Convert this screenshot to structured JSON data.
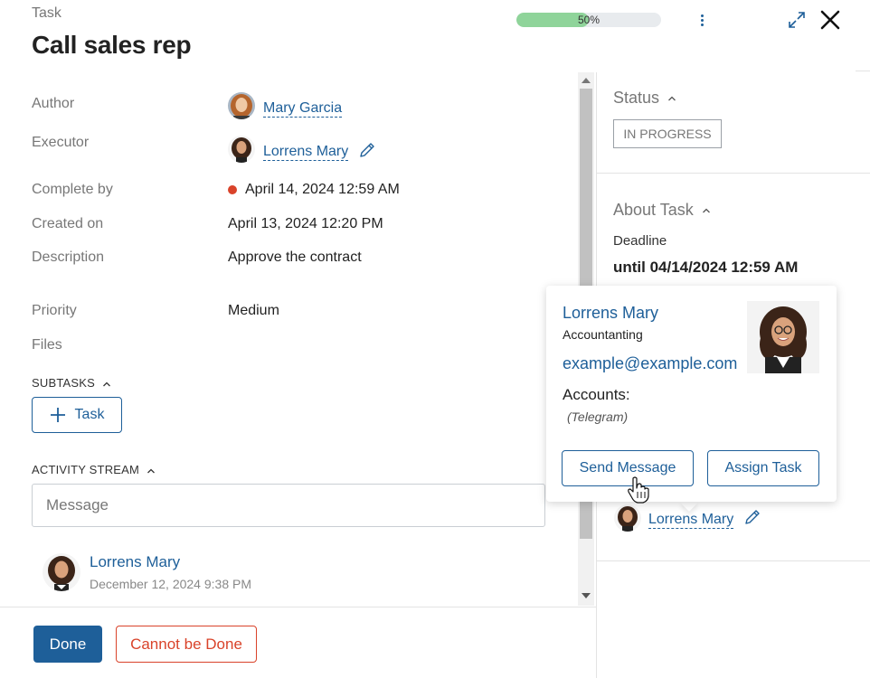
{
  "header": {
    "crumb": "Task",
    "title": "Call sales rep",
    "progress_text": "50%",
    "progress_value": 0.5
  },
  "fields": {
    "author_label": "Author",
    "author_name": "Mary Garcia",
    "executor_label": "Executor",
    "executor_name": "Lorrens Mary",
    "complete_by_label": "Complete by",
    "complete_by_value": "April 14, 2024 12:59 AM",
    "created_on_label": "Created on",
    "created_on_value": "April 13, 2024 12:20 PM",
    "description_label": "Description",
    "description_value": "Approve the contract",
    "priority_label": "Priority",
    "priority_value": "Medium",
    "files_label": "Files"
  },
  "subtasks": {
    "heading": "SUBTASKS",
    "add_label": "Task"
  },
  "activity": {
    "heading": "ACTIVITY STREAM",
    "message_placeholder": "Message",
    "entry": {
      "author": "Lorrens Mary",
      "timestamp": "December 12, 2024 9:38 PM"
    }
  },
  "footer": {
    "done_label": "Done",
    "cannot_label": "Cannot be Done"
  },
  "right_panel": {
    "status_heading": "Status",
    "status_value": "IN PROGRESS",
    "about_heading": "About Task",
    "deadline_label": "Deadline",
    "deadline_value": "until 04/14/2024 12:59 AM",
    "executor_name": "Lorrens Mary"
  },
  "profile_card": {
    "name": "Lorrens Mary",
    "role": "Accountanting",
    "email": "example@example.com",
    "accounts_heading": "Accounts:",
    "accounts_value": "(Telegram)",
    "send_message_label": "Send Message",
    "assign_task_label": "Assign Task"
  },
  "colors": {
    "accent": "#1e5f99",
    "danger": "#d9432a",
    "progress": "#8fd49a"
  }
}
